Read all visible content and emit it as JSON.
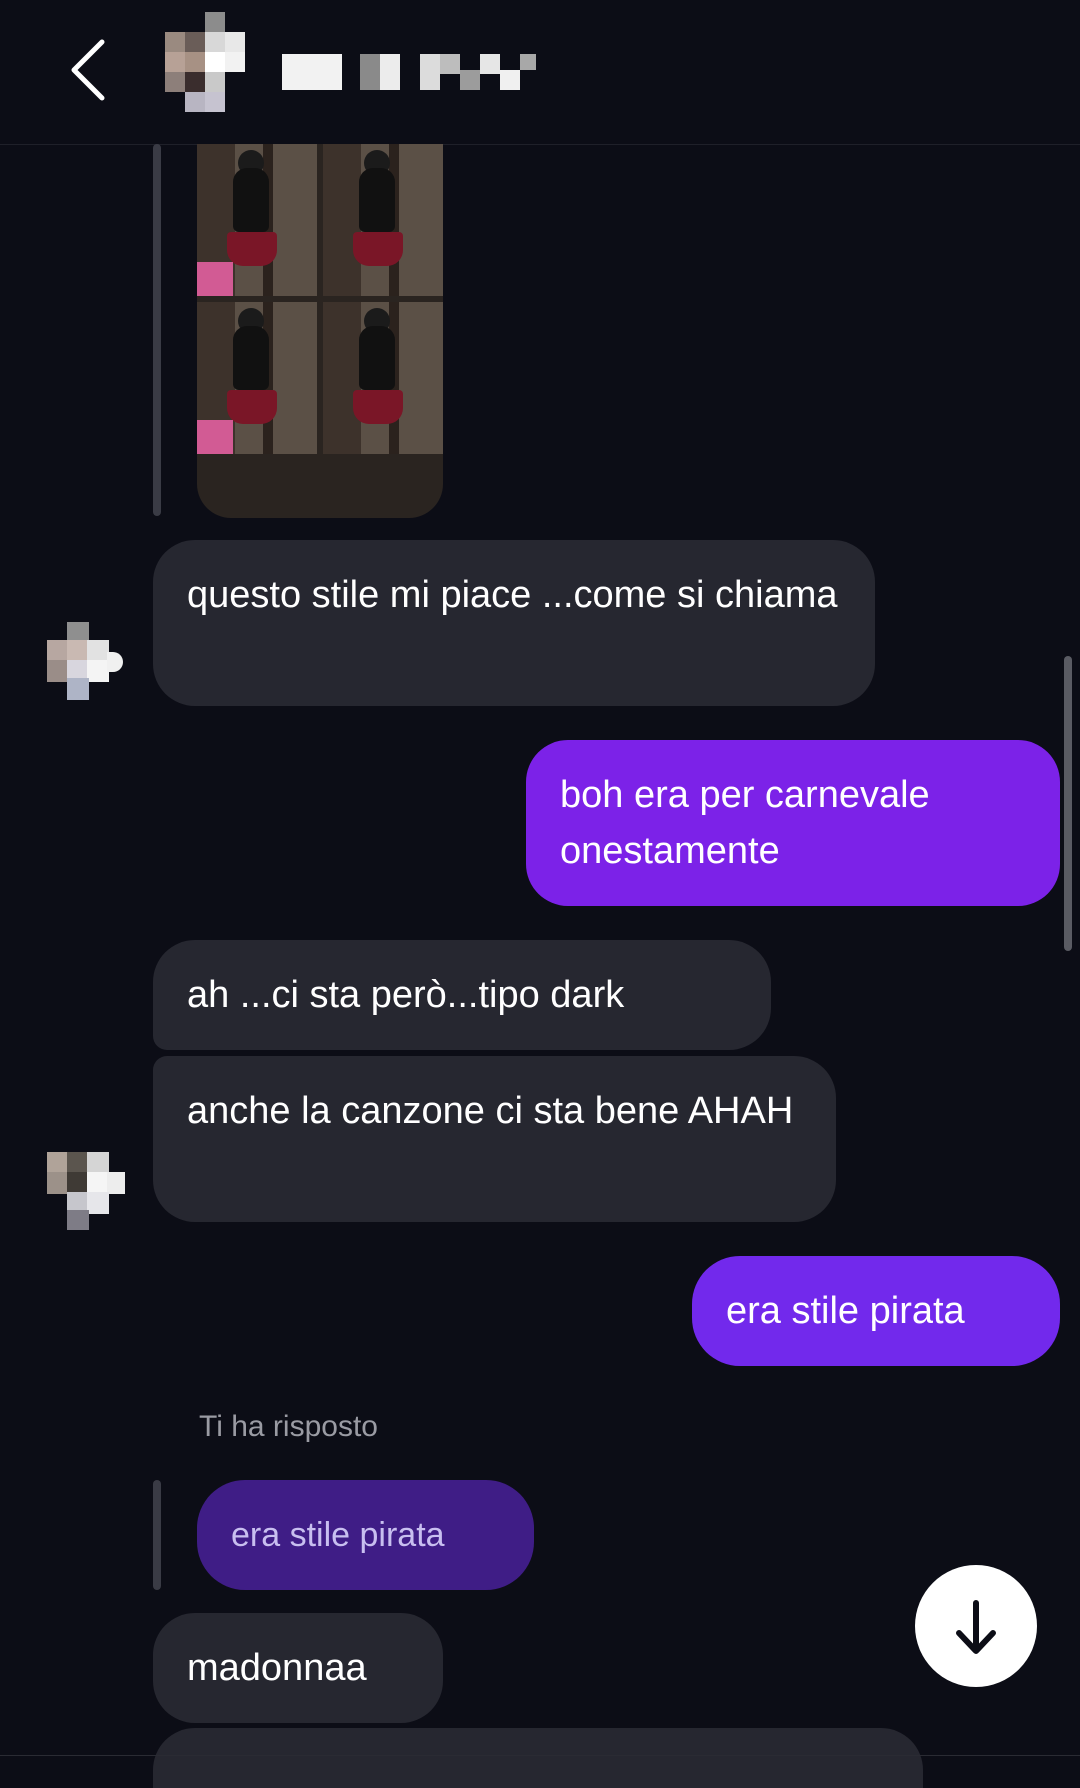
{
  "header": {
    "back_icon": "chevron-left-icon",
    "contact_name": ""
  },
  "messages": [
    {
      "id": "m1",
      "direction": "incoming",
      "text": "questo stile mi piace ...come si chiama"
    },
    {
      "id": "m2",
      "direction": "outgoing",
      "text": "boh era per carnevale onestamente"
    },
    {
      "id": "m3",
      "direction": "incoming",
      "text": "ah ...ci sta però...tipo dark"
    },
    {
      "id": "m4",
      "direction": "incoming",
      "text": "anche la canzone ci sta bene AHAH"
    },
    {
      "id": "m5",
      "direction": "outgoing",
      "text": "era stile pirata"
    },
    {
      "id": "m6",
      "direction": "incoming",
      "text": "madonnaa"
    }
  ],
  "reply": {
    "label": "Ti ha risposto",
    "quoted_text": "era stile pirata"
  },
  "colors": {
    "background": "#0c0d16",
    "incoming_bubble": "#262730",
    "outgoing_bubble": "#7c22e8",
    "quoted_bubble": "#3f1d86"
  },
  "controls": {
    "scroll_down_icon": "arrow-down-icon"
  }
}
